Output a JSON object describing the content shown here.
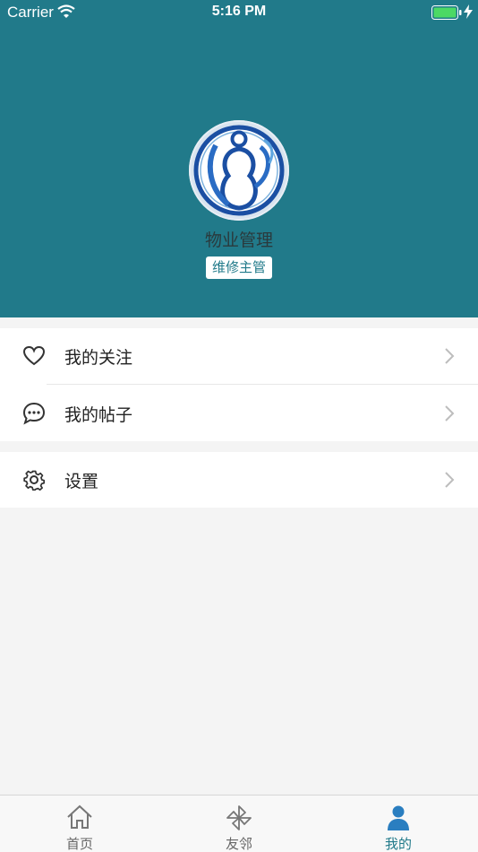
{
  "status_bar": {
    "carrier": "Carrier",
    "time": "5:16 PM"
  },
  "profile": {
    "name": "物业管理",
    "role": "维修主管",
    "avatar_icon": "logo-avatar-icon"
  },
  "menu": {
    "group1": [
      {
        "label": "我的关注",
        "icon": "heart-icon"
      },
      {
        "label": "我的帖子",
        "icon": "chat-bubble-icon"
      }
    ],
    "group2": [
      {
        "label": "设置",
        "icon": "gear-icon"
      }
    ]
  },
  "tabbar": [
    {
      "label": "首页",
      "icon": "home-icon",
      "active": false
    },
    {
      "label": "友邻",
      "icon": "pinwheel-icon",
      "active": false
    },
    {
      "label": "我的",
      "icon": "person-icon",
      "active": true
    }
  ],
  "colors": {
    "brand": "#217a8a",
    "background": "#f4f4f4",
    "battery": "#4cd964"
  }
}
